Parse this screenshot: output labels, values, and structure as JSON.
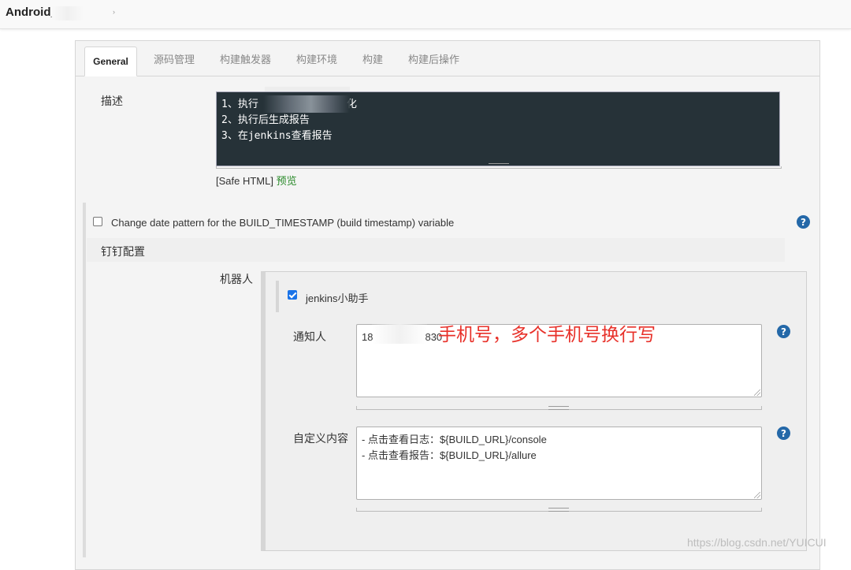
{
  "breadcrumb": {
    "project": "Android_",
    "arrow": "›"
  },
  "tabs": [
    {
      "label": "General"
    },
    {
      "label": "源码管理"
    },
    {
      "label": "构建触发器"
    },
    {
      "label": "构建环境"
    },
    {
      "label": "构建"
    },
    {
      "label": "构建后操作"
    }
  ],
  "description": {
    "label": "描述",
    "lines": [
      "1、执行",
      "2、执行后生成报告",
      "3、在jenkins查看报告"
    ],
    "line1_suffix": "化",
    "safe_html": "[Safe HTML]",
    "preview": "预览"
  },
  "timestamp_option": {
    "label": "Change date pattern for the BUILD_TIMESTAMP (build timestamp) variable",
    "checked": false
  },
  "dingtalk": {
    "section_title": "钉钉配置",
    "robot_label": "机器人",
    "robot": {
      "name": "jenkins小助手",
      "checked": true
    },
    "notify_label": "通知人",
    "notify_value_prefix": "18",
    "notify_value_suffix": "830",
    "custom_label": "自定义内容",
    "custom_lines": [
      "- 点击查看日志：${BUILD_URL}/console",
      "- 点击查看报告：${BUILD_URL}/allure"
    ]
  },
  "annotation": "手机号，多个手机号换行写",
  "help_icon": "?",
  "watermark": "https://blog.csdn.net/YUICUI",
  "colors": {
    "accent": "#2468a8",
    "annotation": "#e8312a",
    "editor_bg": "#263238",
    "preview_link": "#2a8a2a"
  }
}
